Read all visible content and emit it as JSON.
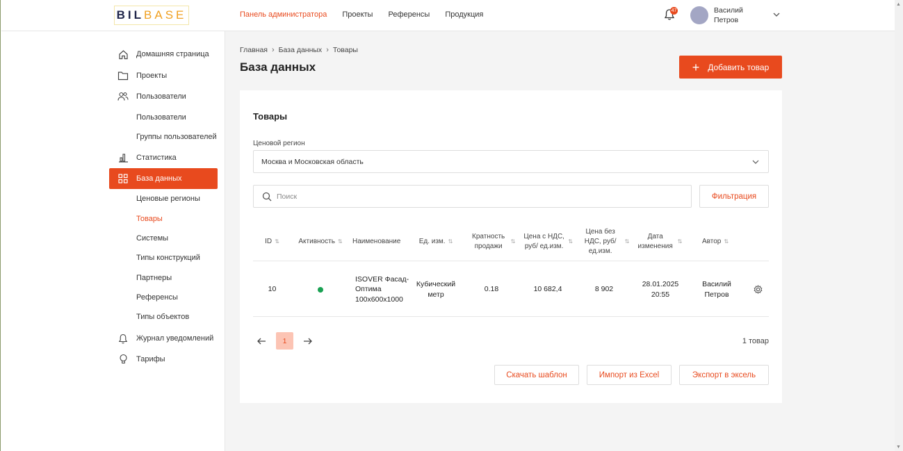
{
  "logo": {
    "part1": "BIL",
    "part2": "BASE"
  },
  "nav": [
    {
      "label": "Панель администратора",
      "active": true
    },
    {
      "label": "Проекты",
      "active": false
    },
    {
      "label": "Референсы",
      "active": false
    },
    {
      "label": "Продукция",
      "active": false
    }
  ],
  "notifications": {
    "count": "47"
  },
  "user": {
    "first_name": "Василий",
    "last_name": "Петров"
  },
  "sidebar": {
    "items": [
      {
        "label": "Домашняя страница",
        "icon": "home-icon"
      },
      {
        "label": "Проекты",
        "icon": "folder-icon"
      },
      {
        "label": "Пользователи",
        "icon": "users-icon"
      },
      {
        "label": "Пользователи",
        "sub": true
      },
      {
        "label": "Группы пользователей",
        "sub": true
      },
      {
        "label": "Статистика",
        "icon": "chart-icon"
      },
      {
        "label": "База данных",
        "icon": "grid-icon",
        "active": true
      },
      {
        "label": "Ценовые регионы",
        "sub": true
      },
      {
        "label": "Товары",
        "sub": true,
        "selected": true
      },
      {
        "label": "Системы",
        "sub": true
      },
      {
        "label": "Типы конструкций",
        "sub": true
      },
      {
        "label": "Партнеры",
        "sub": true
      },
      {
        "label": "Референсы",
        "sub": true
      },
      {
        "label": "Типы объектов",
        "sub": true
      },
      {
        "label": "Журнал уведомлений",
        "icon": "bell-icon"
      },
      {
        "label": "Тарифы",
        "icon": "lightbulb-icon"
      }
    ]
  },
  "breadcrumb": [
    "Главная",
    "База данных",
    "Товары"
  ],
  "page": {
    "title": "База данных",
    "add_button": "Добавить товар"
  },
  "card": {
    "title": "Товары",
    "region_label": "Ценовой регион",
    "region_value": "Москва и Московская область",
    "search_placeholder": "Поиск",
    "filter_button": "Фильтрация"
  },
  "table": {
    "columns": [
      "ID",
      "Активность",
      "Наименование",
      "Ед. изм.",
      "Кратность продажи",
      "Цена с НДС, руб/ ед.изм.",
      "Цена без НДС, руб/ ед.изм.",
      "Дата изменения",
      "Автор"
    ],
    "rows": [
      {
        "id": "10",
        "active": true,
        "name": "ISOVER Фасад-Оптима 100x600x1000",
        "unit": "Кубический метр",
        "multiplicity": "0.18",
        "price_vat": "10 682,4",
        "price_no_vat": "8 902",
        "date": "28.01.2025 20:55",
        "author": "Василий Петров"
      }
    ]
  },
  "pagination": {
    "current": "1",
    "total_text": "1 товар"
  },
  "actions": {
    "download_template": "Скачать шаблон",
    "import_excel": "Импорт из Excel",
    "export_excel": "Экспорт в эксель"
  },
  "colors": {
    "accent": "#e84a1e",
    "active_dot": "#1aa153",
    "page_bg": "#f4f4f4"
  }
}
